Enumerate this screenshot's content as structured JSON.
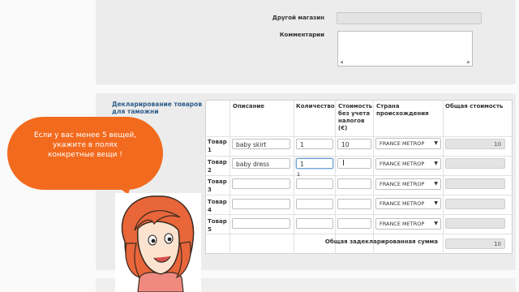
{
  "form": {
    "other_store_label": "Другой магазин",
    "comments_label": "Комментарии"
  },
  "customs": {
    "title": "Декларирование товаров для таможни",
    "headers": {
      "description": "Описание",
      "quantity": "Количество",
      "cost": "Стоимость без учета налогов (€)",
      "country": "Страна происхождения",
      "total": "Общая стоимость"
    },
    "rows": [
      {
        "label": "Товар 1",
        "description": "baby skirt",
        "quantity": "1",
        "cost": "10",
        "country": "FRANCE METROP",
        "total": "10"
      },
      {
        "label": "Товар 2",
        "description": "baby dress",
        "quantity": "1",
        "cost": "",
        "country": "FRANCE METROP",
        "total": ""
      },
      {
        "label": "Товар 3",
        "description": "",
        "quantity": "",
        "cost": "",
        "country": "FRANCE METROP",
        "total": ""
      },
      {
        "label": "Товар 4",
        "description": "",
        "quantity": "",
        "cost": "",
        "country": "FRANCE METROP",
        "total": ""
      },
      {
        "label": "Товар 5",
        "description": "",
        "quantity": "",
        "cost": "",
        "country": "FRANCE METROP",
        "total": ""
      }
    ],
    "dropdown_hint": "1",
    "declared_total_label": "Общая задекларированная сумма",
    "declared_total_value": "10"
  },
  "tip": {
    "lines": [
      "Если у вас менее 5 вещей,",
      "укажите в полях",
      "конкретные вещи !"
    ]
  },
  "colors": {
    "bubble": "#f26a1e",
    "title": "#2d5d8a"
  }
}
